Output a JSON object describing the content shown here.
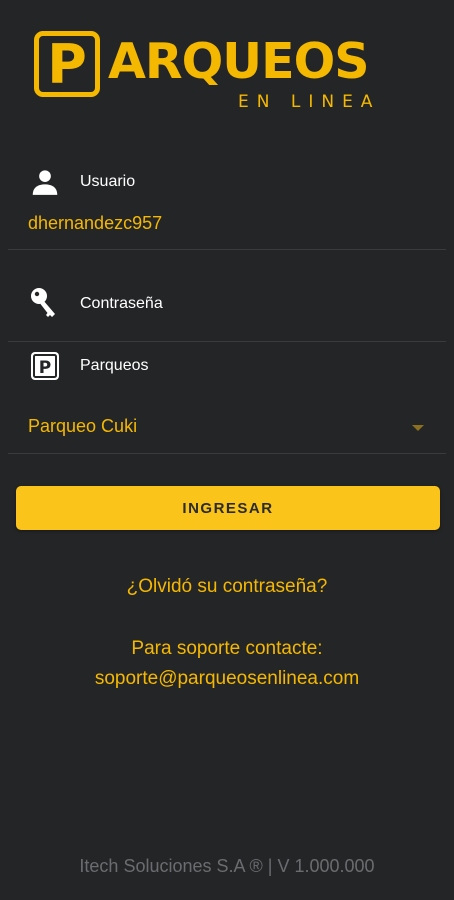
{
  "logo": {
    "letter": "P",
    "word": "ARQUEOS",
    "subtitle": "EN LINEA"
  },
  "form": {
    "user_label": "Usuario",
    "user_value": "dhernandezc957",
    "password_label": "Contraseña",
    "parking_label": "Parqueos",
    "parking_selected": "Parqueo Cuki",
    "parking_icon_letter": "P"
  },
  "actions": {
    "login_label": "INGRESAR",
    "forgot_password": "¿Olvidó su contraseña?"
  },
  "support": {
    "line1": "Para soporte contacte:",
    "email": "soporte@parqueosenlinea.com"
  },
  "footer": {
    "text": "Itech Soluciones S.A ® | V 1.000.000"
  },
  "colors": {
    "background": "#242527",
    "accent": "#f5b800",
    "button": "#fbc41a",
    "divider": "#3a3b3e",
    "footer_text": "#6b6c6f"
  },
  "icons": {
    "user": "person-icon",
    "password": "key-icon",
    "parking": "parking-icon",
    "dropdown": "dropdown-arrow-icon"
  }
}
